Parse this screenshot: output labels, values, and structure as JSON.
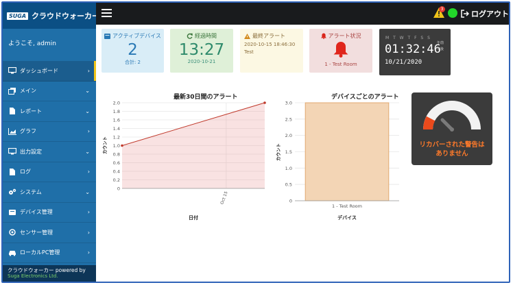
{
  "app": {
    "logo": "SUGA",
    "title": "クラウドウォーカー"
  },
  "sidebar": {
    "welcome": "ようこそ, admin",
    "items": [
      {
        "label": "ダッシュボード",
        "arrow": "›"
      },
      {
        "label": "メイン",
        "arrow": "⌄"
      },
      {
        "label": "レポート",
        "arrow": "⌄"
      },
      {
        "label": "グラフ",
        "arrow": "›"
      },
      {
        "label": "出力設定",
        "arrow": "⌄"
      },
      {
        "label": "ログ",
        "arrow": "›"
      },
      {
        "label": "システム",
        "arrow": "⌄"
      },
      {
        "label": "デバイス管理",
        "arrow": "›"
      },
      {
        "label": "センサー管理",
        "arrow": "›"
      },
      {
        "label": "ローカルPC管理",
        "arrow": "›"
      }
    ],
    "footer_line1": "クラウドウォーカー powered by",
    "footer_line2": "Suga Electronics Ltd."
  },
  "topbar": {
    "alert_count": "3",
    "logout_label": "ログアウト"
  },
  "cards": {
    "active_devices": {
      "title": "アクティブデバイス",
      "value": "2",
      "sub": "合計: 2"
    },
    "elapsed": {
      "title": "経過時間",
      "value": "13:27",
      "sub": "2020-10-21"
    },
    "last_alert": {
      "title": "最終アラート",
      "line1": "2020-10-15 18:46:30",
      "line2": "Test"
    },
    "alert_status": {
      "title": "アラート状況",
      "sub": "1 - Test Room"
    }
  },
  "clock": {
    "days": "M T W T F S S",
    "time": "01:32:46",
    "ampm_top": "午前",
    "ampm_bottom": "午後",
    "date": "10/21/2020"
  },
  "chart_data": [
    {
      "type": "area",
      "title": "最新30日間のアラート",
      "xlabel": "日付",
      "ylabel": "カウント",
      "ylim": [
        0,
        2.0
      ],
      "yticks": [
        "0",
        "0.2",
        "0.4",
        "0.6",
        "0.8",
        "1.0",
        "1.2",
        "1.4",
        "1.6",
        "1.8",
        "2.0"
      ],
      "xtick_label": "Oct 15",
      "points": [
        1,
        2
      ],
      "grid": true
    },
    {
      "type": "bar",
      "title": "デバイスごとのアラート",
      "xlabel": "デバイス",
      "ylabel": "カウント",
      "ylim": [
        0,
        3.0
      ],
      "yticks": [
        "0",
        "0.5",
        "1.0",
        "1.5",
        "2.0",
        "2.5",
        "3.0"
      ],
      "categories": [
        "1 - Test Room"
      ],
      "values": [
        3
      ],
      "grid": true
    }
  ],
  "gauge": {
    "message_line1": "リカバーされた警告は",
    "message_line2": "ありません"
  },
  "colors": {
    "sidebar": "#1f6fa8",
    "topbar": "#191b1d",
    "accent_yellow": "#f0c419",
    "line_chart": "#c0392b",
    "bar_fill": "#f3d5b5",
    "gauge_text": "#ff7a2a"
  }
}
